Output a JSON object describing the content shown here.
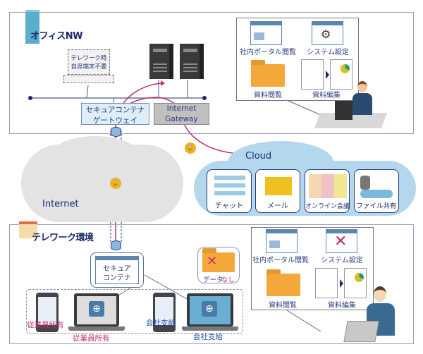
{
  "office": {
    "title": "オフィスNW",
    "dashed_laptop_text": [
      "テレワーク時",
      "自席端末不要"
    ],
    "gateway": [
      "セキュアコンテナ",
      "ゲートウェイ"
    ],
    "internet_gateway": [
      "Internet",
      "Gateway"
    ],
    "tasks": {
      "portal": "社内ポータル閲覧",
      "settings": "システム設定",
      "view": "資料閲覧",
      "edit": "資料編集"
    }
  },
  "internet_label": "Internet",
  "cloud": {
    "label": "Cloud",
    "services": [
      "チャット",
      "メール",
      "オンライン会議",
      "ファイル共有"
    ]
  },
  "telework": {
    "title": "テレワーク環境",
    "secure_container": [
      "セキュア",
      "コンテナ"
    ],
    "no_data": [
      "データ",
      "なし"
    ],
    "employee_owned": "従業員所有",
    "company_issued": "会社支給",
    "tasks": {
      "portal": "社内ポータル閲覧",
      "settings": "システム設定",
      "view": "資料閲覧",
      "edit": "資料編集"
    }
  },
  "colors": {
    "navy": "#1a2a6c",
    "pink": "#c0306a",
    "blue": "#2255aa",
    "cloud": "#b3d8ee",
    "lock": "#f0b020"
  }
}
